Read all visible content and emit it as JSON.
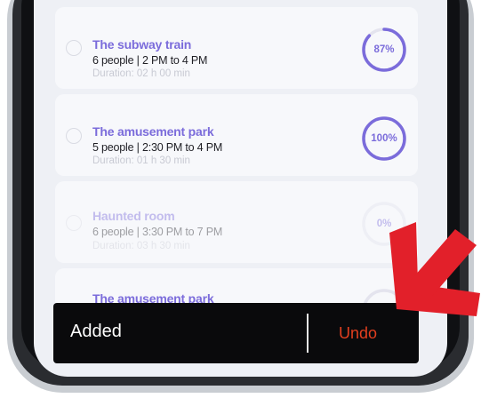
{
  "activities": [
    {
      "title": "The subway train",
      "details": "6 people | 2 PM to 4 PM",
      "duration": "Duration: 02 h 00 min",
      "progress_label": "87%",
      "progress": 0.87
    },
    {
      "title": "The amusement park",
      "details": "5 people | 2:30 PM to 4 PM",
      "duration": "Duration: 01 h 30 min",
      "progress_label": "100%",
      "progress": 1.0
    },
    {
      "title": "Haunted room",
      "details": "6 people | 3:30 PM to 7 PM",
      "duration": "Duration: 03 h 30 min",
      "progress_label": "0%",
      "progress": 0.0
    },
    {
      "title": "The amusement park",
      "details": "",
      "duration": "",
      "progress_label": "",
      "progress": 0.0
    }
  ],
  "snackbar": {
    "message": "Added",
    "action": "Undo"
  },
  "colors": {
    "accent": "#7b6cdb",
    "snackbar_bg": "#0a0a0c",
    "action": "#e23f1f",
    "arrow": "#e2202a"
  },
  "icons": {
    "pointer": "arrow-pointer-icon"
  }
}
